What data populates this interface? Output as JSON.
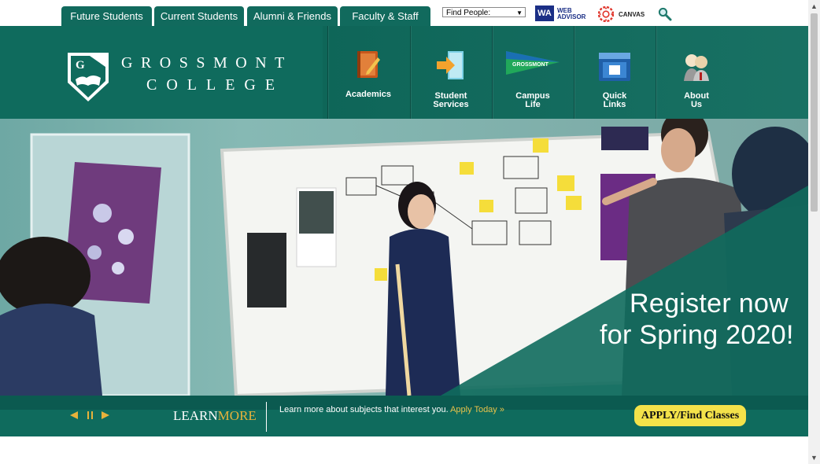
{
  "audience_tabs": [
    {
      "label": "Future Students"
    },
    {
      "label": "Current Students"
    },
    {
      "label": "Alumni & Friends"
    },
    {
      "label": "Faculty & Staff"
    }
  ],
  "tools": {
    "find_people": "Find People:",
    "wa_badge": "WA",
    "wa_line1": "WEB",
    "wa_line2": "ADVISOR",
    "canvas": "CANVAS",
    "search_icon": "search-icon"
  },
  "logo": {
    "line1": "Grossmont",
    "line2": "College",
    "badge": "G"
  },
  "main_nav": [
    {
      "line1": "Academics",
      "line2": "",
      "icon": "book-pencil-icon"
    },
    {
      "line1": "Student",
      "line2": "Services",
      "icon": "door-arrow-icon"
    },
    {
      "line1": "Campus",
      "line2": "Life",
      "icon": "pennant-flag-icon"
    },
    {
      "line1": "Quick",
      "line2": "Links",
      "icon": "web-window-icon"
    },
    {
      "line1": "About",
      "line2": "Us",
      "icon": "people-icon"
    }
  ],
  "hero": {
    "headline_line1": "Register now",
    "headline_line2": "for Spring 2020!",
    "flag_text": "GROSSMONT"
  },
  "slider": {
    "learn": "LEARN",
    "more": "MORE",
    "description": "Learn more about subjects that interest you.",
    "apply_link": "Apply Today »",
    "apply_button": "APPLY/Find Classes"
  },
  "colors": {
    "brand_green": "#0f6b5d",
    "accent_gold": "#e8b23b",
    "apply_yellow": "#f4e24a",
    "wa_blue": "#1b2f86"
  }
}
